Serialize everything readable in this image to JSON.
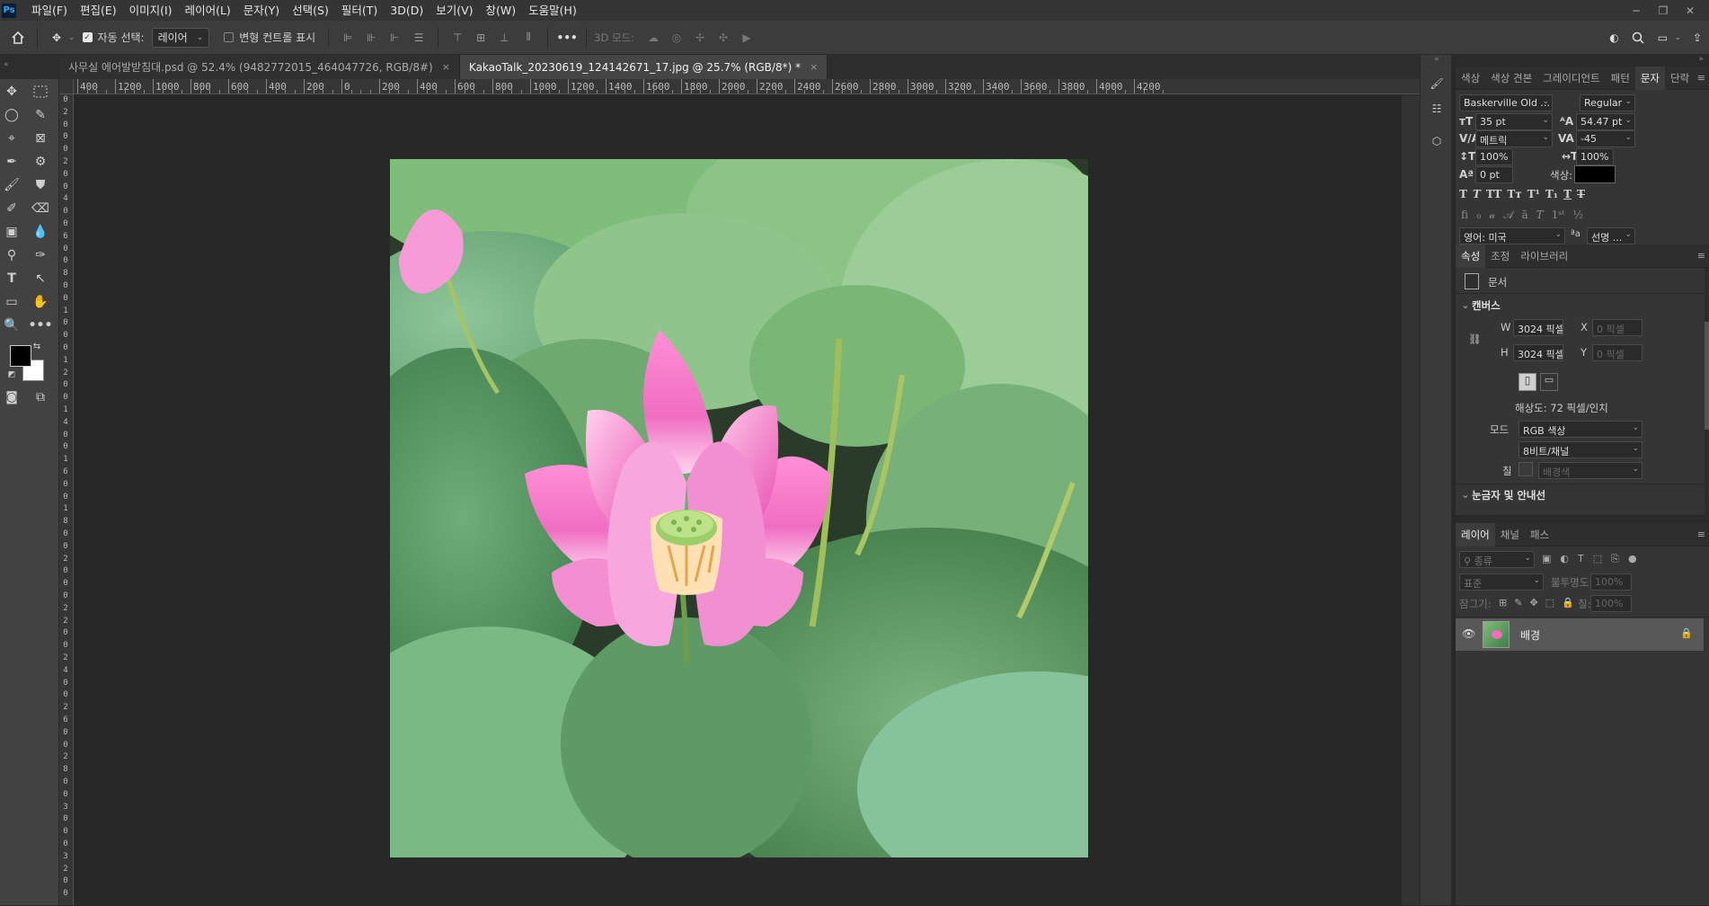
{
  "menubar": {
    "logo": "Ps",
    "items": [
      "파일(F)",
      "편집(E)",
      "이미지(I)",
      "레이어(L)",
      "문자(Y)",
      "선택(S)",
      "필터(T)",
      "3D(D)",
      "보기(V)",
      "창(W)",
      "도움말(H)"
    ]
  },
  "options": {
    "auto_select_label": "자동 선택:",
    "auto_select_value": "레이어",
    "transform_controls_label": "변형 컨트롤 표시",
    "three_d_mode_label": "3D 모드:"
  },
  "tabs": [
    {
      "title": "사무실 에어발받침대.psd @ 52.4% (9482772015_464047726, RGB/8#)",
      "close": "×"
    },
    {
      "title": "KakaoTalk_20230619_124142671_17.jpg @ 25.7% (RGB/8*) *",
      "close": "×"
    }
  ],
  "ruler": {
    "top_labels": [
      "400",
      "1200",
      "1000",
      "800",
      "600",
      "400",
      "200",
      "0",
      "200",
      "400",
      "600",
      "800",
      "1000",
      "1200",
      "1400",
      "1600",
      "1800",
      "2000",
      "2200",
      "2400",
      "2600",
      "2800",
      "3000",
      "3200",
      "3400",
      "3600",
      "3800",
      "4000",
      "4200"
    ],
    "left_labels": [
      "0",
      "2",
      "0",
      "0",
      "0",
      "2",
      "0",
      "0",
      "4",
      "0",
      "0",
      "6",
      "0",
      "0",
      "8",
      "0",
      "0",
      "1",
      "0",
      "0",
      "0",
      "1",
      "2",
      "0",
      "0",
      "1",
      "4",
      "0",
      "0",
      "1",
      "6",
      "0",
      "0",
      "1",
      "8",
      "0",
      "0",
      "2",
      "0",
      "0",
      "0",
      "2",
      "2",
      "0",
      "0",
      "2",
      "4",
      "0",
      "0",
      "2",
      "6",
      "0",
      "0",
      "2",
      "8",
      "0",
      "0",
      "3",
      "0",
      "0",
      "0",
      "3",
      "2",
      "0",
      "0"
    ]
  },
  "char_panel": {
    "tabs": [
      "색상",
      "색상 견본",
      "그레이디언트",
      "패턴",
      "문자",
      "단락"
    ],
    "active_tab": "문자",
    "font_family": "Baskerville Old ...",
    "font_style": "Regular",
    "font_size": "35 pt",
    "leading": "54.47 pt",
    "kerning": "메트릭",
    "tracking": "-45",
    "vertical_scale": "100%",
    "horizontal_scale": "100%",
    "baseline_shift": "0 pt",
    "color_label": "색상:",
    "text_color": "#000000",
    "language": "영어: 미국",
    "antialias_icon": "ªa",
    "antialias": "선명 ..."
  },
  "props_panel": {
    "tabs": [
      "속성",
      "조정",
      "라이브러리"
    ],
    "doc_label": "문서",
    "canvas_section": "캔버스",
    "w_label": "W",
    "w_value": "3024 픽셀",
    "h_label": "H",
    "h_value": "3024 픽셀",
    "x_label": "X",
    "x_placeholder": "0 픽셀",
    "y_label": "Y",
    "y_placeholder": "0 픽셀",
    "resolution": "해상도: 72 픽셀/인치",
    "mode_label": "모드",
    "mode_value": "RGB 색상",
    "bit_value": "8비트/채널",
    "fill_label": "칠",
    "fill_value": "배경색",
    "rulers_section": "눈금자 및 안내선"
  },
  "layers_panel": {
    "tabs": [
      "레이어",
      "채널",
      "패스"
    ],
    "filter_placeholder": "종류",
    "blend_mode": "표준",
    "opacity_label": "불투명도:",
    "opacity_value": "100%",
    "lock_label": "잠그기:",
    "fill_label": "칠:",
    "fill_value": "100%",
    "layers": [
      {
        "name": "배경",
        "visible": true,
        "locked": true
      }
    ]
  }
}
